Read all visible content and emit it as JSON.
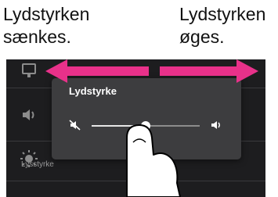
{
  "captions": {
    "left": "Lydstyrken\nsænkes.",
    "right": "Lydstyrken\nøges."
  },
  "volume_popup": {
    "title": "Lydstyrke",
    "level": 0.5,
    "mute_icon": "volume-muted-icon",
    "max_icon": "volume-up-icon"
  },
  "settings_background": {
    "brightness_label": "Lysstyrke",
    "icons": [
      "display-icon",
      "volume-icon",
      "brightness-icon"
    ]
  },
  "overlay": {
    "arrow_color": "#e8318a",
    "gesture": "hand-swipe"
  }
}
